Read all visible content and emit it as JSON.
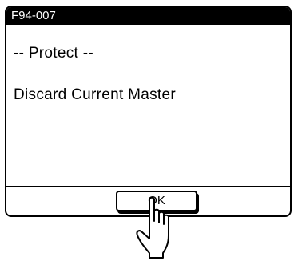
{
  "dialog": {
    "code": "F94-007",
    "title_line": "-- Protect --",
    "message": "Discard Current Master",
    "ok_label": "OK"
  },
  "icons": {
    "pointer": "pointing-hand-icon"
  }
}
